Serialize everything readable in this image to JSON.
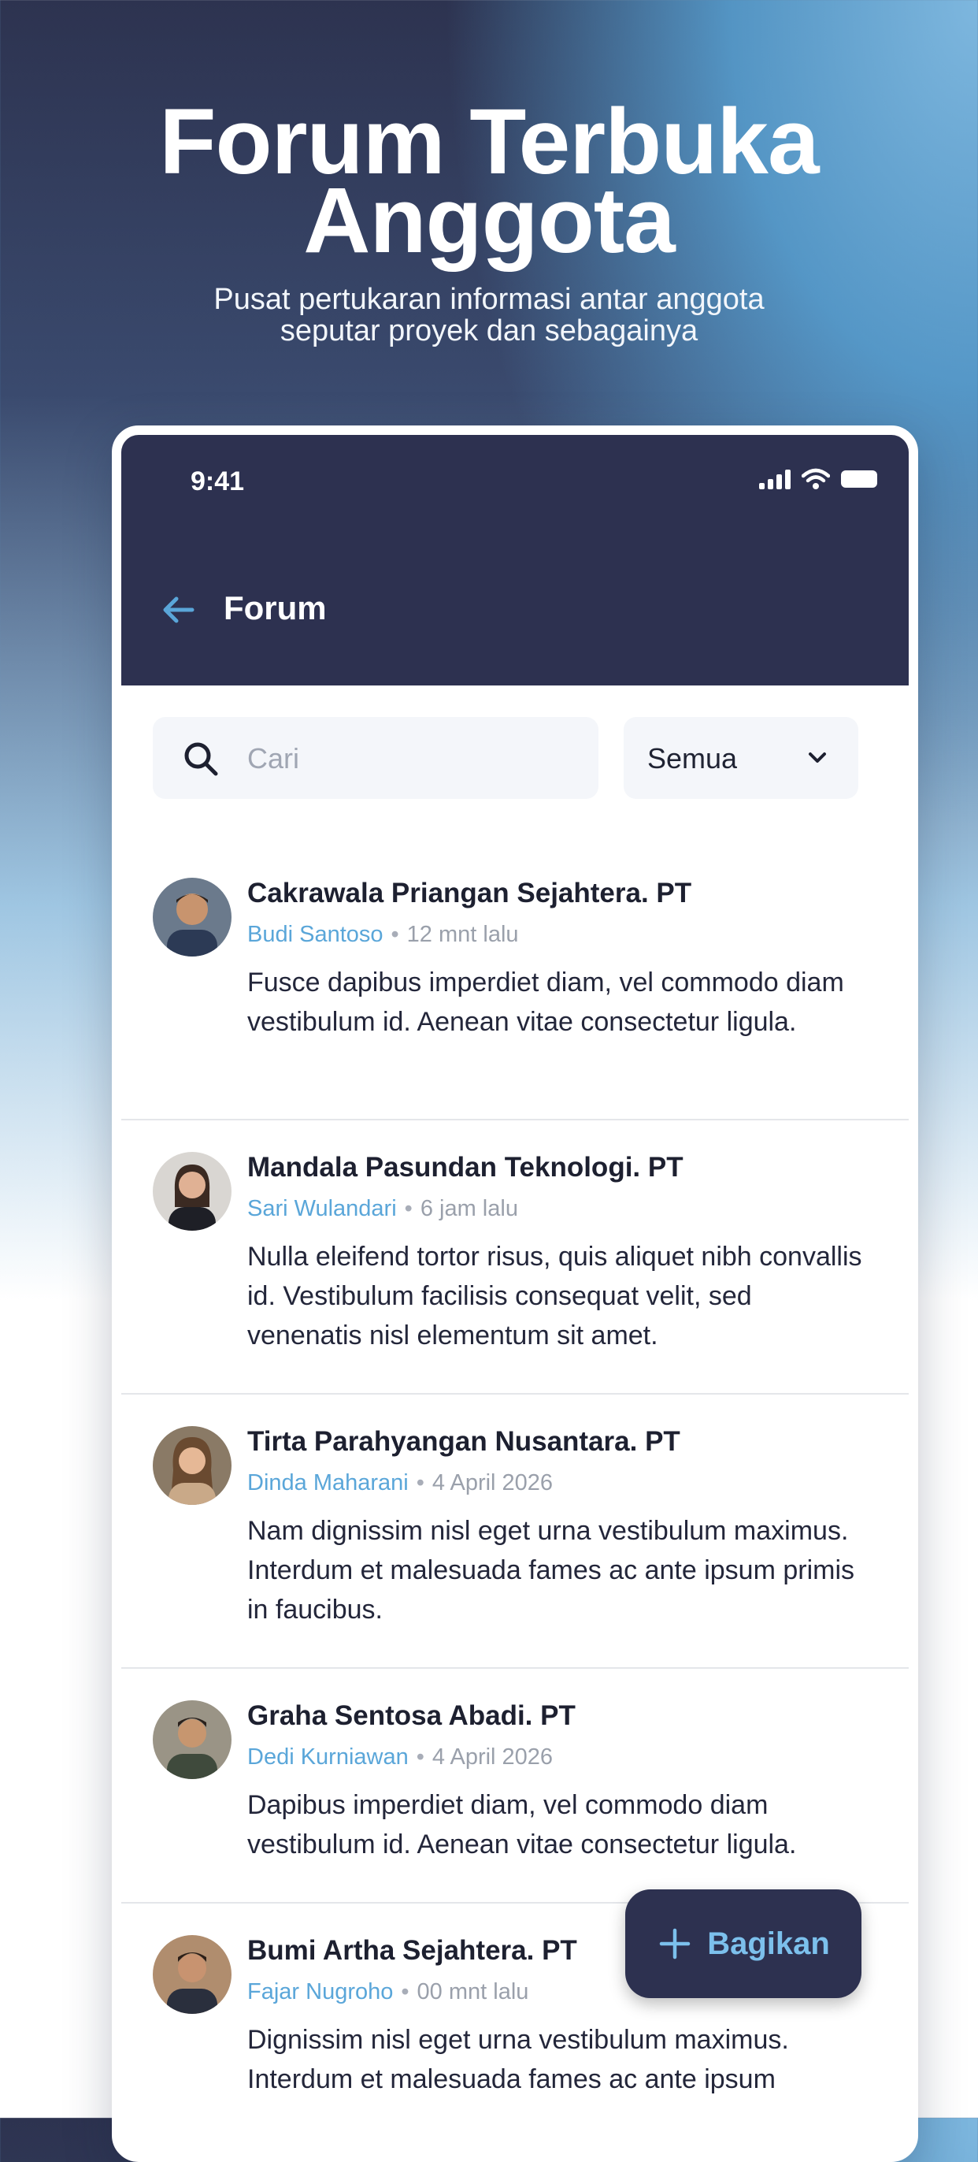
{
  "promo": {
    "headline_line1": "Forum Terbuka",
    "headline_line2": "Anggota",
    "subtitle_line1": "Pusat pertukaran informasi antar anggota",
    "subtitle_line2": "seputar proyek dan sebagainya"
  },
  "status_bar": {
    "time": "9:41"
  },
  "header": {
    "title": "Forum"
  },
  "search": {
    "placeholder": "Cari",
    "value": ""
  },
  "filter": {
    "selected": "Semua"
  },
  "posts": [
    {
      "company": "Cakrawala Priangan Sejahtera. PT",
      "author": "Budi Santoso",
      "time": "12 mnt lalu",
      "body": "Fusce dapibus imperdiet diam, vel commodo diam vestibulum id. Aenean vitae consectetur ligula."
    },
    {
      "company": "Mandala Pasundan Teknologi. PT",
      "author": "Sari Wulandari",
      "time": "6 jam lalu",
      "body": "Nulla eleifend tortor risus, quis aliquet nibh convallis id. Vestibulum facilisis consequat velit, sed venenatis nisl elementum sit amet."
    },
    {
      "company": "Tirta Parahyangan Nusantara. PT",
      "author": "Dinda Maharani",
      "time": "4 April 2026",
      "body": "Nam dignissim nisl eget urna vestibulum maximus. Interdum et malesuada fames ac ante ipsum primis in faucibus."
    },
    {
      "company": "Graha Sentosa Abadi. PT",
      "author": "Dedi Kurniawan",
      "time": "4 April 2026",
      "body": "Dapibus imperdiet diam, vel commodo diam vestibulum id. Aenean vitae consectetur ligula."
    },
    {
      "company": "Bumi Artha Sejahtera. PT",
      "author": "Fajar Nugroho",
      "time": "00 mnt lalu",
      "body": "Dignissim nisl eget urna vestibulum maximus. Interdum et malesuada fames ac ante ipsum"
    }
  ],
  "fab": {
    "label": "Bagikan"
  },
  "colors": {
    "dark": "#2d3150",
    "accent": "#5aa6d9"
  }
}
